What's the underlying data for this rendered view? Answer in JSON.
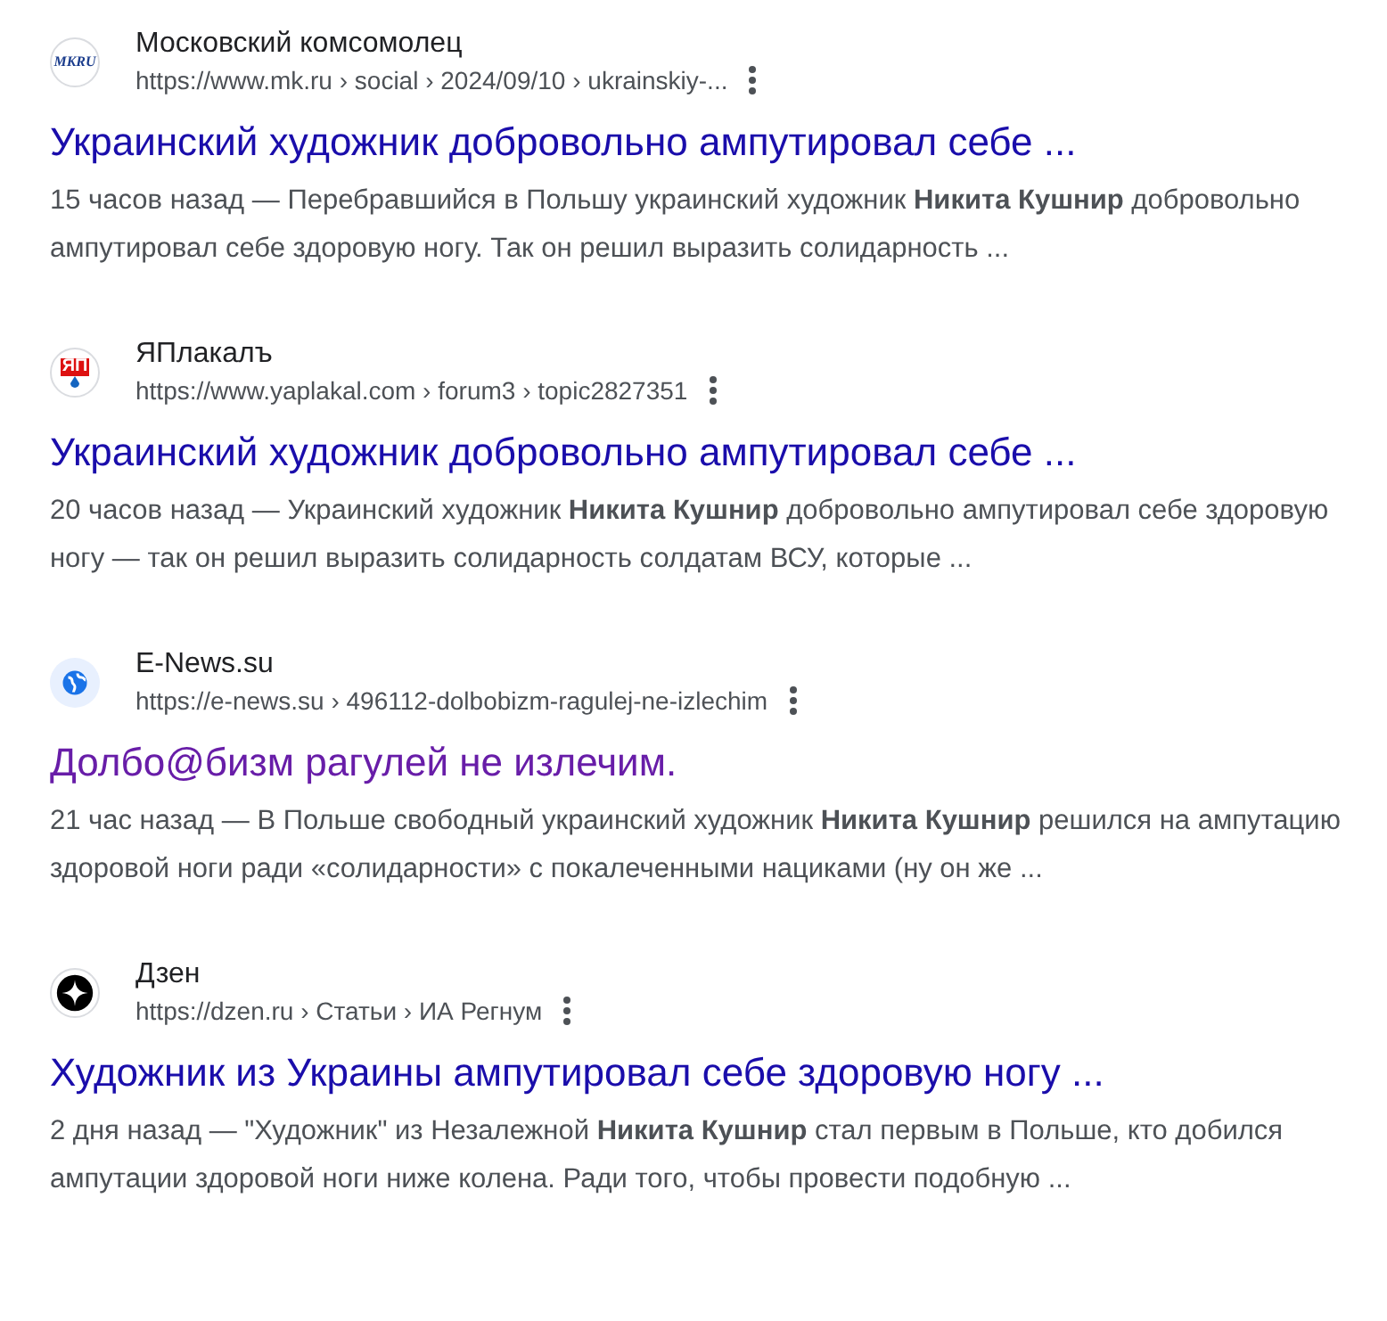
{
  "results": [
    {
      "favicon": {
        "kind": "mk",
        "text": "MKRU"
      },
      "site": "Московский комсомолец",
      "url": "https://www.mk.ru › social › 2024/09/10 › ukrainskiy-...",
      "title": "Украинский художник добровольно ампутировал себе ...",
      "visited": false,
      "snippet": "15 часов назад — Перебравшийся в Польшу украинский художник **Никита Кушнир** добровольно ампутировал себе здоровую ногу. Так он решил выразить солидарность ..."
    },
    {
      "favicon": {
        "kind": "yaplakal",
        "text": "ЯП"
      },
      "site": "ЯПлакалъ",
      "url": "https://www.yaplakal.com › forum3 › topic2827351",
      "title": "Украинский художник добровольно ампутировал себе ...",
      "visited": false,
      "snippet": "20 часов назад — Украинский художник **Никита Кушнир** добровольно ампутировал себе здоровую ногу — так он решил выразить солидарность солдатам ВСУ, которые ..."
    },
    {
      "favicon": {
        "kind": "globe"
      },
      "site": "E-News.su",
      "url": "https://e-news.su › 496112-dolbobizm-ragulej-ne-izlechim",
      "title": "Долбо@бизм рагулей не излечим.",
      "visited": true,
      "snippet": "21 час назад — В Польше свободный украинский художник **Никита Кушнир** решился на ампутацию здоровой ноги ради «солидарности» с покалеченными нациками (ну он же ..."
    },
    {
      "favicon": {
        "kind": "dzen"
      },
      "site": "Дзен",
      "url": "https://dzen.ru › Статьи › ИА Регнум",
      "title": "Художник из Украины ампутировал себе здоровую ногу ...",
      "visited": false,
      "snippet": "2 дня назад — \"Художник\" из Незалежной **Никита Кушнир** стал первым в Польше, кто добился ампутации здоровой ноги ниже колена. Ради того, чтобы провести подобную ..."
    }
  ]
}
